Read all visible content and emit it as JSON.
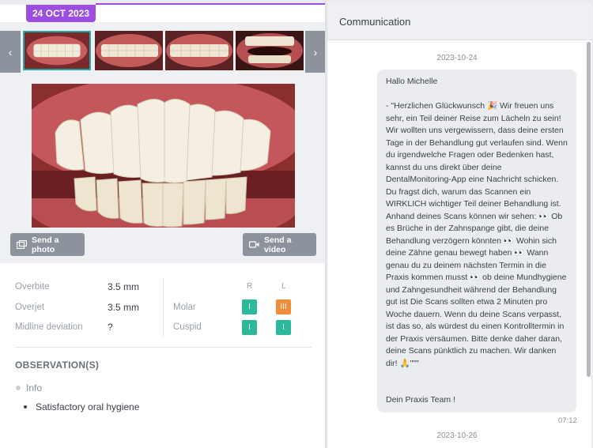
{
  "gallery": {
    "date": "24 OCT 2023",
    "prev_label": "‹",
    "next_label": "›",
    "send_photo": "Send a photo",
    "send_video": "Send a video"
  },
  "measurements": [
    {
      "label": "Overbite",
      "value": "3.5 mm"
    },
    {
      "label": "Overjet",
      "value": "3.5 mm"
    },
    {
      "label": "Midline deviation",
      "value": "?"
    }
  ],
  "classification": {
    "col_right": "R",
    "col_left": "L",
    "rows": [
      {
        "label": "Molar",
        "right": "I",
        "left": "III",
        "right_color": "#2cb89a",
        "left_color": "#f08c3a"
      },
      {
        "label": "Cuspid",
        "right": "I",
        "left": "I",
        "right_color": "#2cb89a",
        "left_color": "#2cb89a"
      }
    ]
  },
  "observations": {
    "title": "OBSERVATION(S)",
    "category": "Info",
    "items": [
      "Satisfactory oral hygiene"
    ]
  },
  "communication": {
    "title": "Communication",
    "date1": "2023-10-24",
    "message": "Hallo Michelle\n\n- \"Herzlichen Glückwunsch 🎉 Wir freuen uns sehr, ein Teil deiner Reise zum Lächeln zu sein! Wir wollten uns vergewissern, dass deine ersten Tage in der Behandlung gut verlaufen sind. Wenn du irgendwelche Fragen oder Bedenken hast, kannst du uns direkt über deine DentalMonitoring-App eine Nachricht schicken. Du fragst dich, warum das Scannen ein WIRKLICH wichtiger Teil deiner Behandlung ist. Anhand deines Scans können wir sehen: 👀 Ob es Brüche in der Zahnspange gibt, die deine Behandlung verzögern könnten 👀 Wohin sich deine Zähne genau bewegt haben 👀 Wann genau du zu deinem nächsten Termin in die Praxis kommen musst 👀 ob deine Mundhygiene und Zahngesundheit während der Behandlung gut ist Die Scans sollten etwa 2 Minuten pro Woche dauern. Wenn du deine Scans verpasst, ist das so, als würdest du einen Kontrolltermin in der Praxis versäumen. Bitte denke daher daran, deine Scans pünktlich zu machen. Wir danken dir! 🙏\"\"\"\n\n\nDein Praxis Team !",
    "time": "07:12",
    "date2": "2023-10-26"
  },
  "colors": {
    "accent": "#9c4ee0",
    "teal": "#2cb89a",
    "orange": "#f08c3a"
  }
}
